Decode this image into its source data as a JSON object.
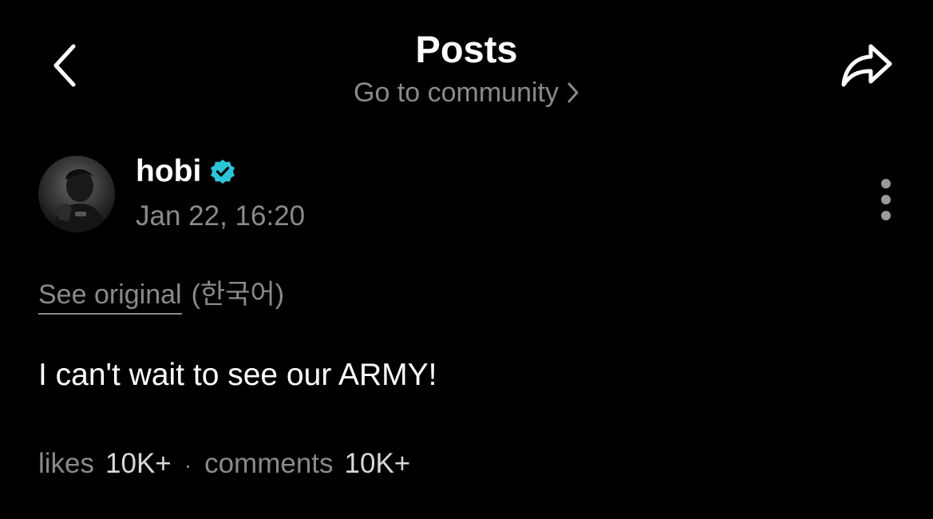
{
  "header": {
    "title": "Posts",
    "community_link": "Go to community"
  },
  "post": {
    "author": "hobi",
    "verified": true,
    "date": "Jan 22, 16:20",
    "see_original": "See original",
    "language": "(한국어)",
    "body": "I can't wait to see our ARMY!",
    "likes_label": "likes",
    "likes_count": "10K+",
    "separator": "·",
    "comments_label": "comments",
    "comments_count": "10K+"
  },
  "icons": {
    "back": "chevron-left-icon",
    "share": "share-arrow-icon",
    "community_chevron": "chevron-right-icon",
    "verified": "verified-badge-icon",
    "more": "more-vertical-icon"
  },
  "colors": {
    "background": "#000000",
    "text_primary": "#ffffff",
    "text_secondary": "#8a8a8a",
    "verified_badge": "#2ec4d8"
  }
}
